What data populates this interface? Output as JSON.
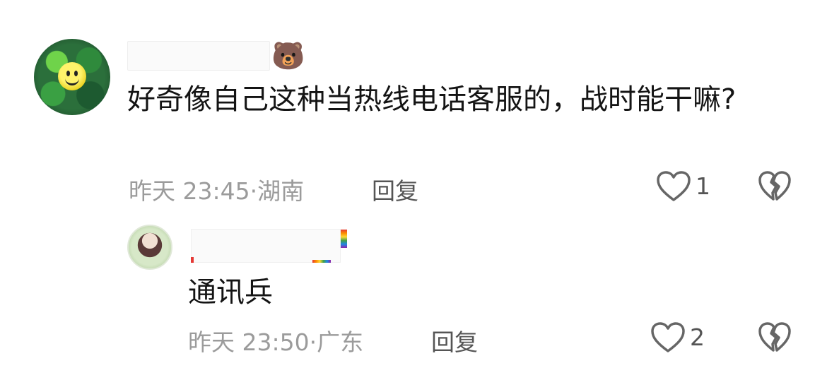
{
  "comment": {
    "user_badge": "🐻",
    "text": "好奇像自己这种当热线电话客服的，战时能干嘛?",
    "time": "昨天 23:45",
    "location": "湖南",
    "reply_label": "回复",
    "like_count": "1"
  },
  "reply": {
    "text": "通讯兵",
    "time": "昨天 23:50",
    "location": "广东",
    "reply_label": "回复",
    "like_count": "2"
  },
  "icons": {
    "like": "heart-outline-icon",
    "dislike": "broken-heart-icon",
    "avatar_main": "smiley-avatar",
    "avatar_reply": "anime-girl-avatar"
  },
  "colors": {
    "meta": "#9b9b9b",
    "text": "#141414",
    "icon": "#666666"
  }
}
